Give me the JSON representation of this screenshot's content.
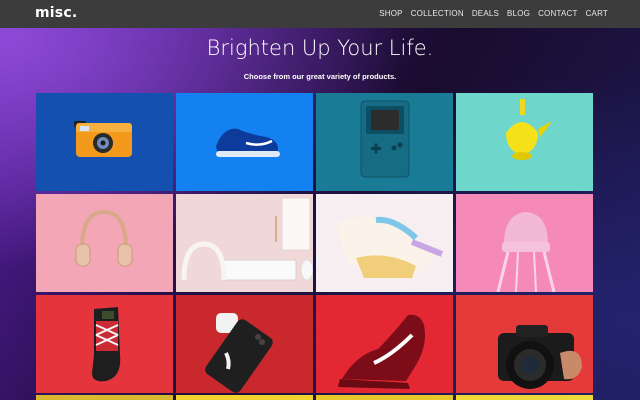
{
  "brand": "misc.",
  "nav": {
    "items": [
      "SHOP",
      "COLLECTION",
      "DEALS",
      "BLOG",
      "CONTACT",
      "CART"
    ]
  },
  "hero": {
    "title": "Brighten Up Your Life.",
    "subtitle": "Choose from our great variety of products."
  },
  "products": [
    {
      "name": "camera",
      "icon": "camera-icon",
      "bg": "#1350b0"
    },
    {
      "name": "sneaker",
      "icon": "sneaker-icon",
      "bg": "#1381f0"
    },
    {
      "name": "game console",
      "icon": "gameboy-icon",
      "bg": "#197b96"
    },
    {
      "name": "teapot",
      "icon": "teapot-icon",
      "bg": "#6fd6cc"
    },
    {
      "name": "headphones",
      "icon": "headphones-icon",
      "bg": "#f2a6b6"
    },
    {
      "name": "desk setup",
      "icon": "keyboard-icon",
      "bg": "#f0d8d8"
    },
    {
      "name": "sneakers",
      "icon": "sneakers-icon",
      "bg": "#f6eef0"
    },
    {
      "name": "chair",
      "icon": "chair-icon",
      "bg": "#f58ab8"
    },
    {
      "name": "socks",
      "icon": "sock-icon",
      "bg": "#e5343c"
    },
    {
      "name": "phone and earbuds",
      "icon": "phone-icon",
      "bg": "#c9282c"
    },
    {
      "name": "running shoe",
      "icon": "running-shoe-icon",
      "bg": "#e32834"
    },
    {
      "name": "camera",
      "icon": "dslr-camera-icon",
      "bg": "#e53a3a"
    }
  ],
  "colors": {
    "nav_bg": "#3c3c3c",
    "bottom_strip": [
      "#d9b830",
      "#f2d22e",
      "#e8c72a",
      "#f0d838"
    ]
  }
}
